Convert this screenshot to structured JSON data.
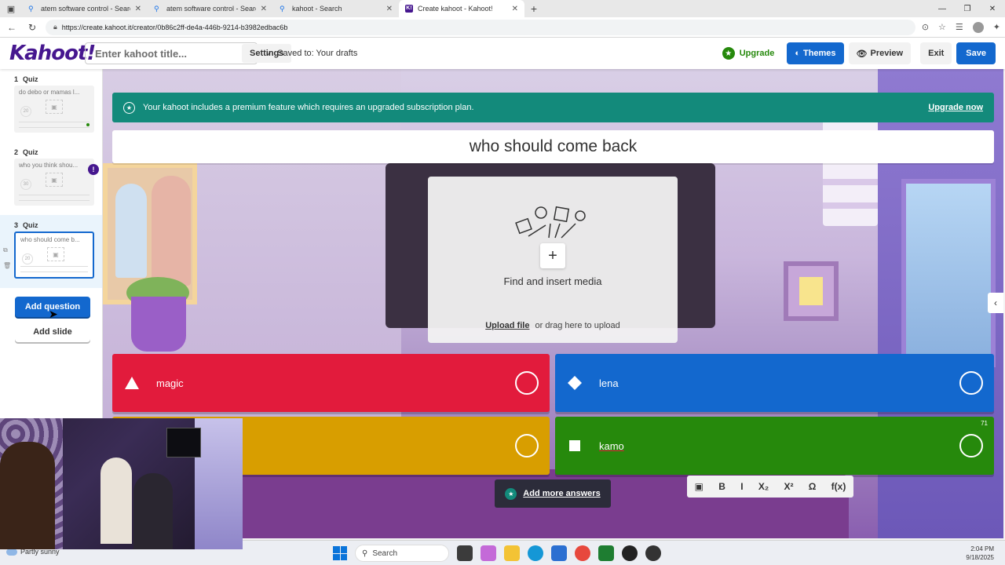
{
  "browser": {
    "tabs": [
      {
        "title": "atem software control - Search",
        "favicon": "search-icon"
      },
      {
        "title": "atem software control - Search",
        "favicon": "search-icon"
      },
      {
        "title": "kahoot - Search",
        "favicon": "search-icon"
      },
      {
        "title": "Create kahoot - Kahoot!",
        "favicon": "kahoot-icon",
        "favicon_text": "K!"
      }
    ],
    "url": "https://create.kahoot.it/creator/0b86c2ff-de4a-446b-9214-b3982edbac6b"
  },
  "header": {
    "logo": "Kahoot!",
    "title_placeholder": "Enter kahoot title...",
    "settings_label": "Settings",
    "saved_text": "Saved to: Your drafts",
    "upgrade_label": "Upgrade",
    "themes_label": "Themes",
    "preview_label": "Preview",
    "exit_label": "Exit",
    "save_label": "Save"
  },
  "sidebar": {
    "slides": [
      {
        "number": "1",
        "type": "Quiz",
        "question": "do debo or mamas l...",
        "time": "20"
      },
      {
        "number": "2",
        "type": "Quiz",
        "question": "who you think shou...",
        "time": "30",
        "warning": "!"
      },
      {
        "number": "3",
        "type": "Quiz",
        "question": "who should come b...",
        "time": "20"
      }
    ],
    "add_question_label": "Add question",
    "add_slide_label": "Add slide"
  },
  "editor": {
    "premium_text": "Your kahoot includes a premium feature which requires an upgraded subscription plan.",
    "premium_link": "Upgrade now",
    "question": "who should come back",
    "media_title": "Find and insert media",
    "media_upload_link": "Upload file",
    "media_upload_text": "or drag here to upload",
    "answers": [
      {
        "text": "magic",
        "shape": "triangle",
        "color": "#e21b3c"
      },
      {
        "text": "lena",
        "shape": "diamond",
        "color": "#1368ce"
      },
      {
        "text": "",
        "shape": "circle",
        "color": "#d89e00"
      },
      {
        "text": "kamo",
        "shape": "square",
        "color": "#26890c",
        "char_count": "71"
      }
    ],
    "add_answers_label": "Add more answers",
    "format_bar": [
      "image-icon",
      "B",
      "I",
      "X₂",
      "X²",
      "Ω",
      "f(x)"
    ]
  },
  "taskbar": {
    "weather": "Partly sunny",
    "search_label": "Search",
    "time": "2:04 PM",
    "date": "9/18/2025"
  },
  "colors": {
    "kahoot_purple": "#46178f",
    "blue": "#1368ce",
    "green": "#26890c",
    "teal": "#138a7b"
  }
}
